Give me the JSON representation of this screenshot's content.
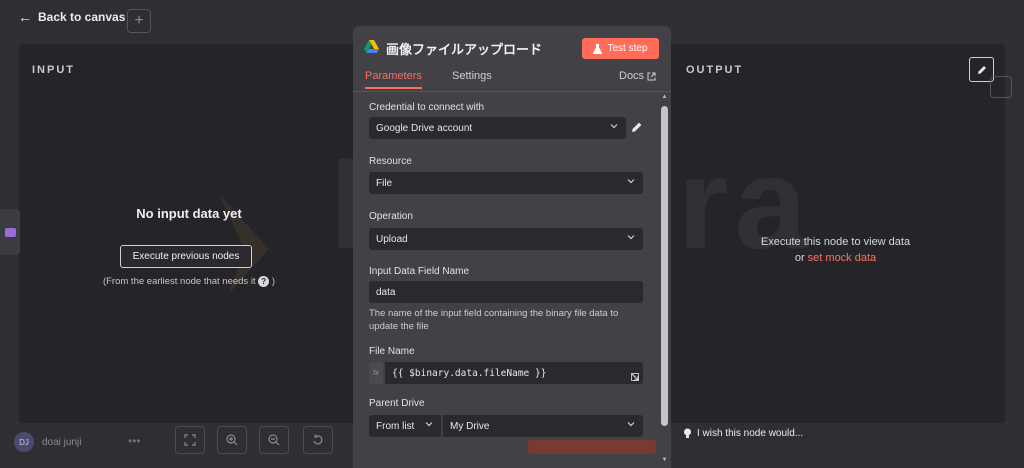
{
  "topbar": {
    "back_label": "Back to canvas"
  },
  "input_panel": {
    "title": "INPUT",
    "empty_message": "No input data yet",
    "execute_button": "Execute previous nodes",
    "note_prefix": "(From the earliest node that needs it ",
    "note_suffix": " )"
  },
  "output_panel": {
    "title": "OUTPUT",
    "message_line1": "Execute this node to view data",
    "message_or": "or ",
    "mock_link": "set mock data"
  },
  "watermark": {
    "text": "Digicra"
  },
  "node": {
    "title": "画像ファイルアップロード",
    "test_button": "Test step",
    "tabs": [
      {
        "label": "Parameters"
      },
      {
        "label": "Settings"
      },
      {
        "label": "Docs"
      }
    ],
    "credential": {
      "label": "Credential to connect with",
      "value": "Google Drive account"
    },
    "resource": {
      "label": "Resource",
      "value": "File"
    },
    "operation": {
      "label": "Operation",
      "value": "Upload"
    },
    "input_field": {
      "label": "Input Data Field Name",
      "value": "data",
      "hint": "The name of the input field containing the binary file data to update the file"
    },
    "file_name": {
      "label": "File Name",
      "fx": "fx",
      "value": "{{ $binary.data.fileName }}"
    },
    "parent_drive": {
      "label": "Parent Drive",
      "mode": "From list",
      "value": "My Drive"
    }
  },
  "footer": {
    "user_initials": "DJ",
    "user_name": "doai junji",
    "wish_text": "I wish this node would..."
  },
  "colors": {
    "accent": "#ff6d5a",
    "background": "#2e2e33",
    "panel": "#252529",
    "modal": "#414146"
  }
}
